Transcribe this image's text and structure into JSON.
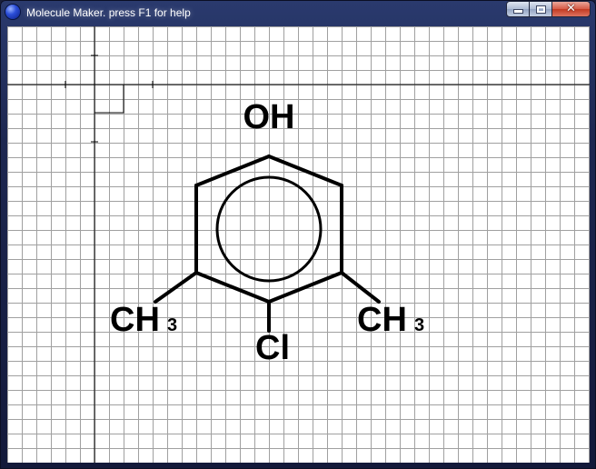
{
  "window": {
    "title": "Molecule Maker. press  F1 for help",
    "controls": {
      "minimize": "minimize",
      "maximize": "maximize",
      "close": "✕"
    }
  },
  "molecule": {
    "atoms": {
      "hydroxyl": "OH",
      "chlorine": "Cl",
      "methyl_left": {
        "symbol": "CH",
        "subscript": "3"
      },
      "methyl_right": {
        "symbol": "CH",
        "subscript": "3"
      }
    }
  },
  "colors": {
    "canvas": "#ffffff",
    "grid": "#a0a0a0",
    "ink": "#000000"
  }
}
